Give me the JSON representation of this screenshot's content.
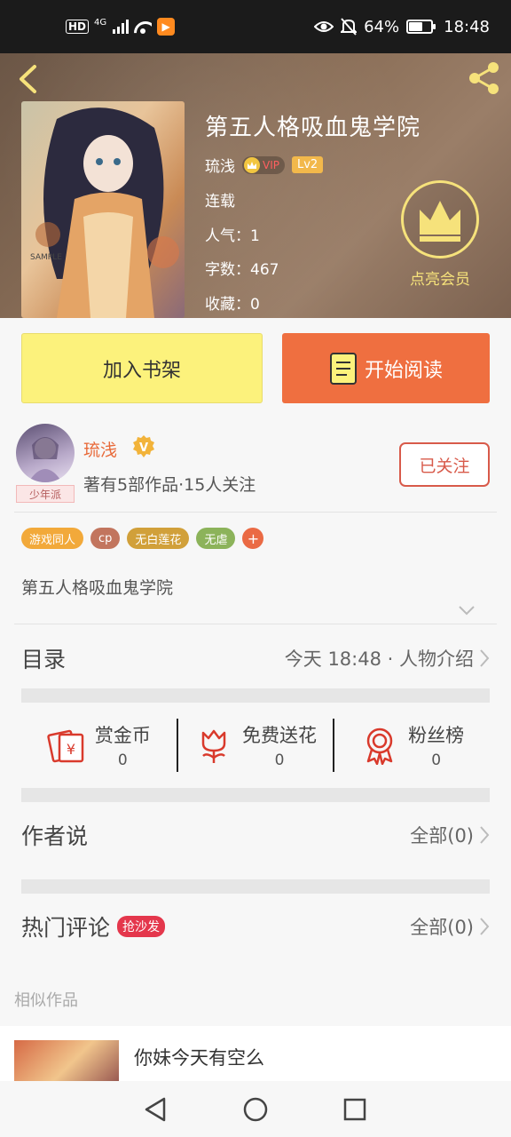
{
  "status_bar": {
    "hd": "HD",
    "network": "4G",
    "app_badge": "▶",
    "battery": "64%",
    "time": "18:48",
    "icons": [
      "signal-icon",
      "wifi-icon",
      "eye-icon",
      "mute-bell-icon",
      "battery-icon"
    ]
  },
  "book": {
    "title": "第五人格吸血鬼学院",
    "author": "琉浅",
    "vip_label": "VIP",
    "level": "Lv2",
    "status": "连载",
    "popularity": "人气：1",
    "word_count": "字数：467",
    "collected": "收藏：0",
    "vip_cta": "点亮会员"
  },
  "actions": {
    "add_shelf": "加入书架",
    "start_read": "开始阅读"
  },
  "author": {
    "name": "琉浅",
    "verified": "V",
    "tag": "少年派",
    "stats": "著有5部作品·15人关注",
    "follow_label": "已关注"
  },
  "tags": [
    {
      "label": "游戏同人",
      "color": "#f2a93a"
    },
    {
      "label": "cp",
      "color": "#c2755e"
    },
    {
      "label": "无白莲花",
      "color": "#d1a03a"
    },
    {
      "label": "无虐",
      "color": "#8cb35a"
    }
  ],
  "tag_more": "+",
  "description": "第五人格吸血鬼学院",
  "catalog": {
    "title": "目录",
    "latest": "今天 18:48 · 人物介绍"
  },
  "rewards": [
    {
      "label": "赏金币",
      "count": "0",
      "icon": "money-envelope-icon"
    },
    {
      "label": "免费送花",
      "count": "0",
      "icon": "flower-icon"
    },
    {
      "label": "粉丝榜",
      "count": "0",
      "icon": "medal-icon"
    }
  ],
  "author_say": {
    "title": "作者说",
    "all": "全部(0)"
  },
  "comments": {
    "title": "热门评论",
    "badge": "抢沙发",
    "all": "全部(0)"
  },
  "similar": {
    "label": "相似作品",
    "items": [
      {
        "title": "你妹今天有空么"
      }
    ]
  },
  "colors": {
    "accent": "#ef6f40",
    "shelf_button": "#fcf27c",
    "vip_gold": "#f6e27b",
    "follow_red": "#d85a4a"
  }
}
